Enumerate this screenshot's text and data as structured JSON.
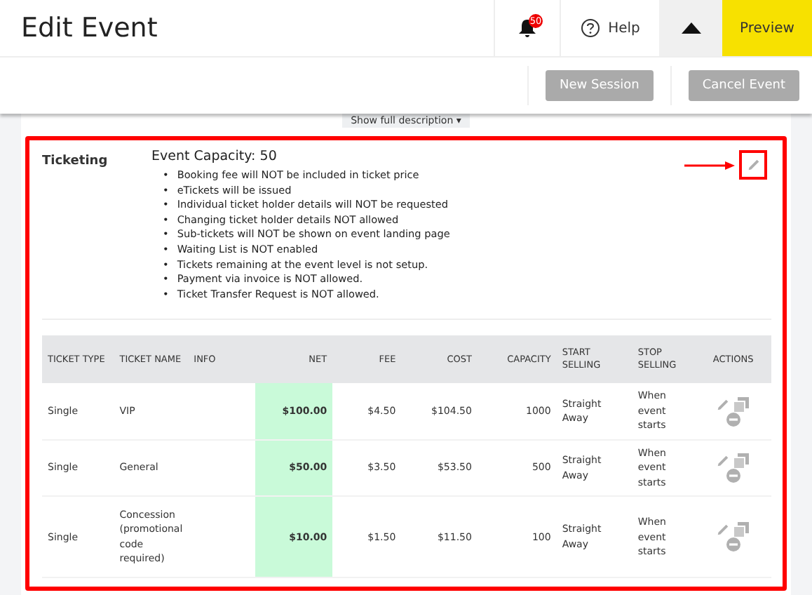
{
  "header": {
    "title": "Edit Event",
    "notification_count": "50",
    "help": "Help",
    "preview": "Preview"
  },
  "actions": [
    "New Session",
    "Cancel Event"
  ],
  "show_description": "Show full description ▾",
  "ticketing": {
    "label": "Ticketing",
    "capacity": "Event Capacity: 50",
    "bullet": "•",
    "notes": [
      "Booking fee will NOT be included in ticket price",
      "eTickets will be issued",
      "Individual ticket holder details will NOT be requested",
      "Changing ticket holder details NOT allowed",
      "Sub-tickets will NOT be shown on event landing page",
      "Waiting List is NOT enabled",
      "Tickets remaining at the event level is not setup.",
      "Payment via invoice is NOT allowed.",
      "Ticket Transfer Request is NOT allowed."
    ]
  },
  "table": {
    "columns": [
      {
        "label": "TICKET TYPE",
        "kind": "text",
        "highlighted": false
      },
      {
        "label": "TICKET NAME",
        "kind": "text",
        "highlighted": false
      },
      {
        "label": "INFO",
        "kind": "text",
        "highlighted": false
      },
      {
        "label": "NET",
        "kind": "number",
        "highlighted": true
      },
      {
        "label": "FEE",
        "kind": "number",
        "highlighted": false
      },
      {
        "label": "COST",
        "kind": "number",
        "highlighted": false
      },
      {
        "label": "CAPACITY",
        "kind": "number",
        "highlighted": false
      },
      {
        "label": "START SELLING",
        "kind": "text",
        "highlighted": false
      },
      {
        "label": "STOP SELLING",
        "kind": "text",
        "highlighted": false
      },
      {
        "label": "ACTIONS",
        "kind": "actions",
        "highlighted": false
      }
    ],
    "rows": [
      [
        "Single",
        "VIP",
        "",
        "$100.00",
        "$4.50",
        "$104.50",
        "1000",
        "Straight Away",
        "When event starts",
        ""
      ],
      [
        "Single",
        "General",
        "",
        "$50.00",
        "$3.50",
        "$53.50",
        "500",
        "Straight Away",
        "When event starts",
        ""
      ],
      [
        "Single",
        "Concession (promotional code required)",
        "",
        "$10.00",
        "$1.50",
        "$11.50",
        "100",
        "Straight Away",
        "When event starts",
        ""
      ]
    ]
  }
}
